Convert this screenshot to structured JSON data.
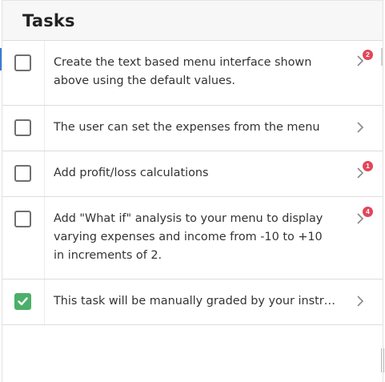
{
  "header": {
    "title": "Tasks"
  },
  "tasks": [
    {
      "text": "Create the text based menu interface shown above using the default values.",
      "checked": false,
      "badge": "2"
    },
    {
      "text": "The user can set the expenses from the menu",
      "checked": false,
      "badge": ""
    },
    {
      "text": "Add profit/loss calculations",
      "checked": false,
      "badge": "1"
    },
    {
      "text": "Add \"What if\" analysis to your menu to display varying expenses and income from -10 to +10 in increments of 2.",
      "checked": false,
      "badge": "4"
    },
    {
      "text": "This task will be manually graded by your instructor",
      "checked": true,
      "badge": ""
    }
  ],
  "icons": {
    "checkbox_checked": "check-icon",
    "row_action": "chevron-right-icon"
  },
  "colors": {
    "checked_green": "#4caf6a",
    "badge_red": "#e0475a",
    "accent_blue": "#3a7bd5"
  }
}
